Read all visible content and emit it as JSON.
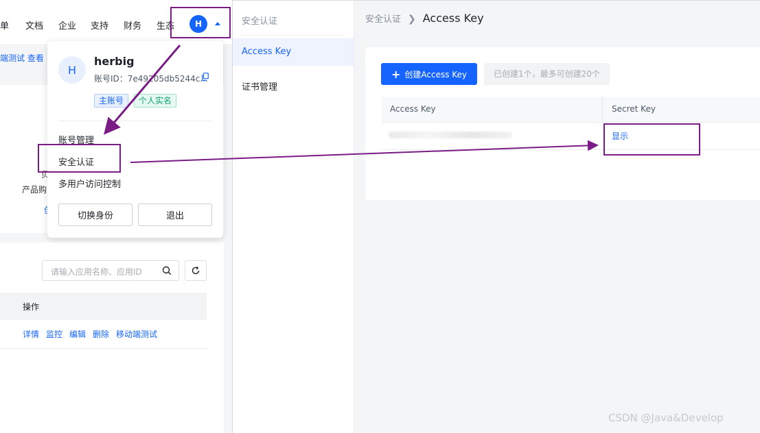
{
  "topnav": {
    "items": [
      "单",
      "文档",
      "企业",
      "支持",
      "财务",
      "生态"
    ],
    "avatar_letter": "H"
  },
  "background": {
    "links_text": "端测试 查看",
    "frag1": "贝",
    "frag2": "产品购",
    "frag3": "创",
    "search_placeholder": "请输入应用名称、应用ID",
    "table_header": "操作",
    "row_actions": [
      "详情",
      "监控",
      "编辑",
      "删除",
      "移动端测试"
    ]
  },
  "user_menu": {
    "avatar_letter": "H",
    "name": "herbig",
    "account_id": "账号ID：7e49205db5244c...",
    "badges": [
      "主账号",
      "个人实名"
    ],
    "items": [
      "账号管理",
      "安全认证",
      "多用户访问控制"
    ],
    "switch_label": "切换身份",
    "logout_label": "退出"
  },
  "security": {
    "sidebar": {
      "title": "安全认证",
      "items": [
        "Access Key",
        "证书管理"
      ],
      "active": "Access Key"
    },
    "breadcrumb": {
      "parent": "安全认证",
      "current": "Access Key"
    },
    "create_button": "创建Access Key",
    "quota_text": "已创建1个，最多可创建20个",
    "table": {
      "columns": [
        "Access Key",
        "Secret Key"
      ],
      "rows": [
        {
          "access_key": "",
          "secret_action": "显示"
        }
      ]
    }
  },
  "watermark": "CSDN @Java&Develop",
  "colors": {
    "primary": "#1664ff",
    "annotation": "#7a1b86",
    "success": "#0aa574"
  }
}
